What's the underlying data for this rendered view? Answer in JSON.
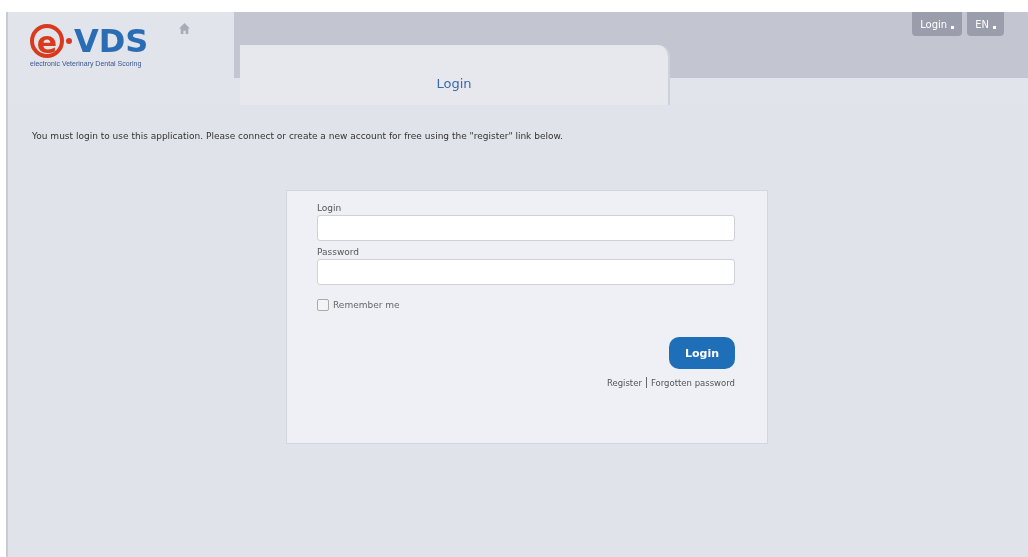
{
  "logo": {
    "mark": "e",
    "name": "VDS",
    "subtitle": "electronic Veterinary Dental Scoring"
  },
  "top_buttons": [
    {
      "label": "Login"
    },
    {
      "label": "EN"
    }
  ],
  "tab": {
    "label": "Login",
    "selected": true
  },
  "message": "You must login to use this application. Please connect or create a new account for free using the \"register\" link below.",
  "form": {
    "fields": [
      {
        "label": "Login"
      },
      {
        "label": "Password"
      }
    ],
    "remember": {
      "label": "Remember me",
      "checked": false
    },
    "submit": "Login",
    "links": [
      {
        "label": "Register"
      },
      {
        "label": "Forgotten password"
      }
    ]
  }
}
